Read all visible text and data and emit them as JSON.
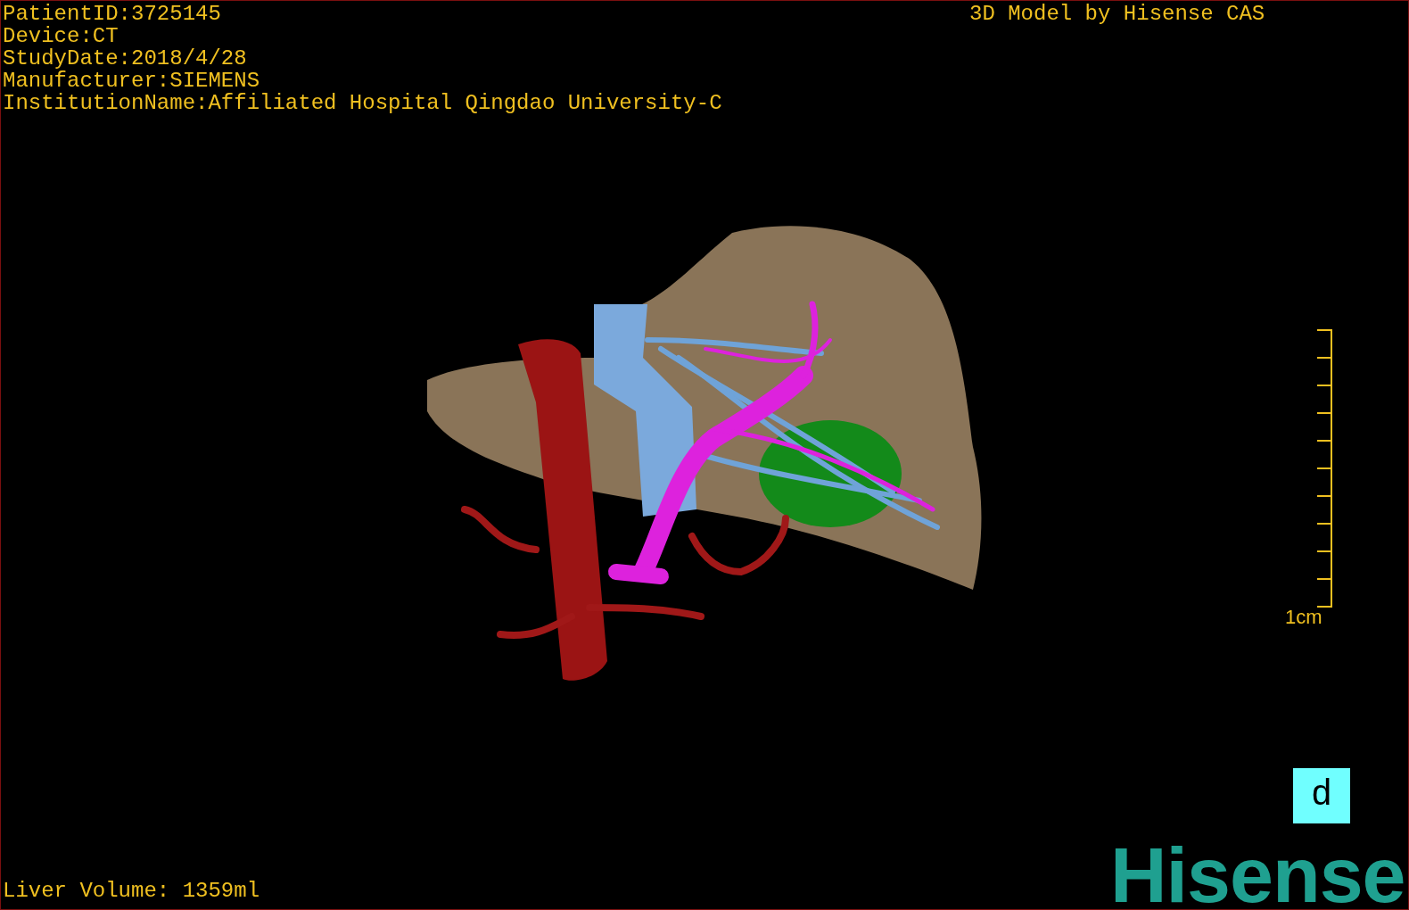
{
  "info_lines": [
    "PatientID:3725145",
    "Device:CT",
    "StudyDate:2018/4/28",
    "Manufacturer:SIEMENS",
    "InstitutionName:Affiliated Hospital Qingdao University-C"
  ],
  "header_right": "3D Model by Hisense CAS",
  "scale_bar": {
    "label": "1cm"
  },
  "view_label": "d",
  "logo": "Hisense",
  "volume": "Liver Volume: 1359ml"
}
